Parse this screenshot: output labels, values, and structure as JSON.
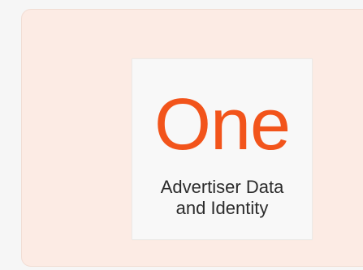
{
  "logo": {
    "wordmark": "One",
    "tagline_line1": "Advertiser Data",
    "tagline_line2": "and Identity"
  },
  "colors": {
    "brand_orange": "#f2541b",
    "card_background": "#fcebe4",
    "tile_background": "#f8f8f8",
    "text_dark": "#2b2b2b"
  }
}
